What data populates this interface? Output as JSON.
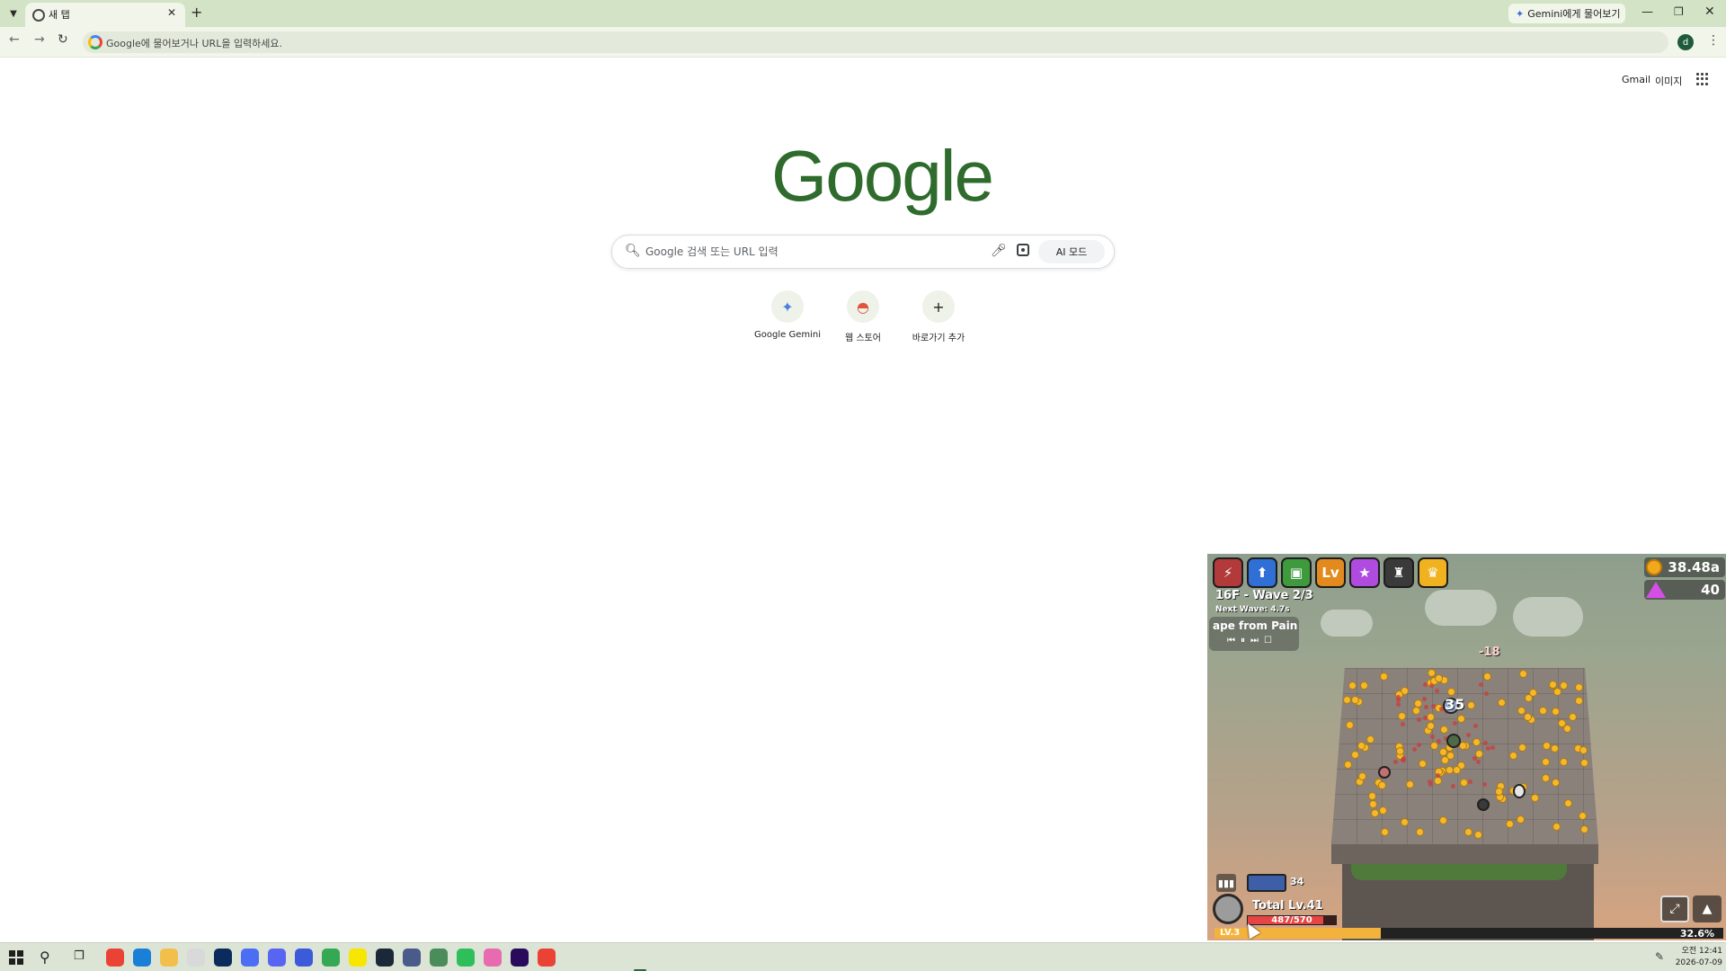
{
  "browser": {
    "tab_title": "새 탭",
    "tab_close": "✕",
    "new_tab": "+",
    "gemini_button": "Gemini에게 물어보기",
    "omnibox_text": "Google에 물어보거나 URL을 입력하세요.",
    "profile_initial": "d",
    "window_controls": {
      "minimize": "—",
      "maximize": "❐",
      "close": "✕"
    }
  },
  "ntp": {
    "header_links": {
      "gmail": "Gmail",
      "images": "이미지"
    },
    "logo_text": "Google",
    "search": {
      "placeholder": "Google 검색 또는 URL 입력",
      "ai_mode_label": "AI 모드"
    },
    "shortcuts": [
      {
        "label": "Google Gemini",
        "icon": "gemini-icon"
      },
      {
        "label": "웹 스토어",
        "icon": "webstore-icon"
      },
      {
        "label": "바로가기 추가",
        "icon": "plus-icon"
      }
    ]
  },
  "game": {
    "gold": "38.48a",
    "gems": "40",
    "wave_title": "16F - Wave 2/3",
    "next_wave": "Next Wave: 4.7s",
    "music_title": "ape from Pain",
    "damage_numbers": [
      "-18",
      "35"
    ],
    "skill_count": "34",
    "total_level": "Total Lv.41",
    "hp_current": 487,
    "hp_max": 570,
    "hp_text": "487/570",
    "level_label": "LV.3",
    "xp_fraction": 0.326,
    "xp_percent": "32.6%",
    "colors": {
      "gold": "#f5b82a",
      "gem": "#d64ee8",
      "hp": "#e54545",
      "xp": "#f3b23b"
    }
  },
  "taskbar": {
    "apps": [
      "chrome-icon",
      "edge-icon",
      "file-explorer-icon",
      "paint-icon",
      "photoshop-icon",
      "whale-icon",
      "discord-icon",
      "app-icon",
      "chrome-icon",
      "kakaotalk-icon",
      "steam-icon",
      "app-icon",
      "app-icon",
      "app-icon",
      "app-icon",
      "after-effects-icon",
      "chrome-active-icon"
    ],
    "time": "오전 12:41",
    "date": "2026-07-09"
  }
}
